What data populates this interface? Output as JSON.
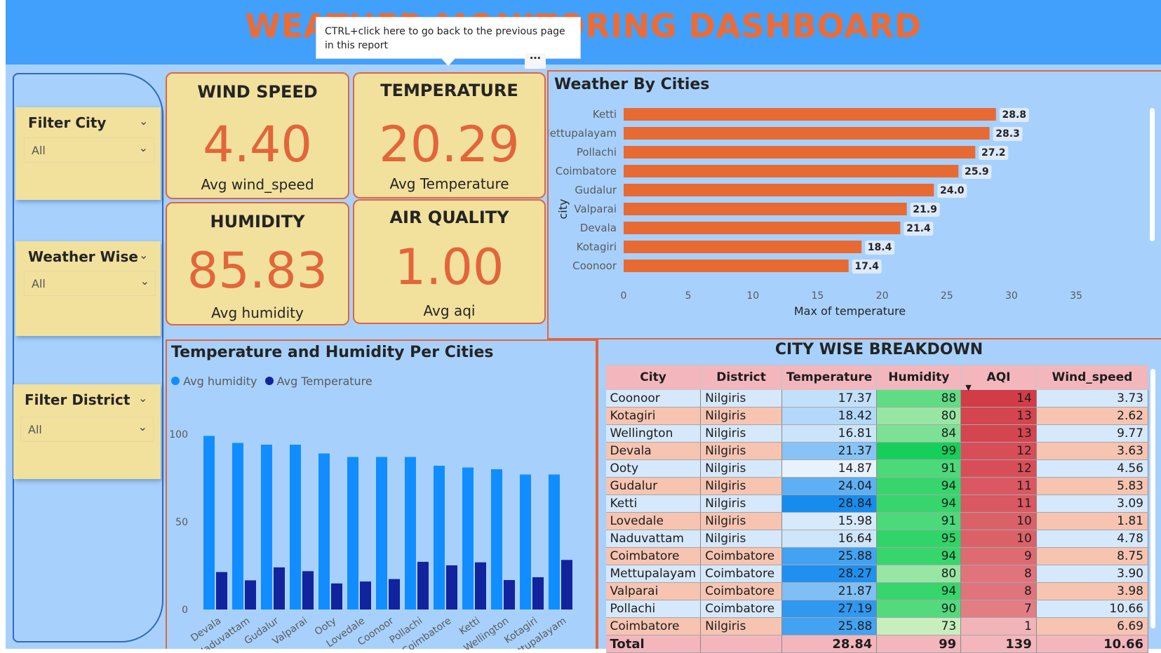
{
  "header": {
    "title": "WEATHER MONITORING DASHBOARD"
  },
  "tooltip": {
    "text": "CTRL+click here to go back to the previous page in this report",
    "more_icon": "⋯"
  },
  "filters": [
    {
      "title": "Filter City",
      "value": "All"
    },
    {
      "title": "Weather Wise",
      "value": "All"
    },
    {
      "title": "Filter District",
      "value": "All"
    }
  ],
  "kpis": {
    "wind": {
      "title": "WIND SPEED",
      "value": "4.40",
      "subtitle": "Avg wind_speed"
    },
    "temperature": {
      "title": "TEMPERATURE",
      "value": "20.29",
      "subtitle": "Avg Temperature"
    },
    "humidity": {
      "title": "HUMIDITY",
      "value": "85.83",
      "subtitle": "Avg humidity"
    },
    "aqi": {
      "title": "AIR QUALITY",
      "value": "1.00",
      "subtitle": "Avg aqi"
    }
  },
  "colors": {
    "bar": "#e86a33",
    "humidity": "#118dff",
    "temperature": "#12239e",
    "kpi_bg": "#f1e19d",
    "accent": "#e2653b",
    "canvas": "#a7d1fc"
  },
  "chart_data": [
    {
      "type": "bar",
      "orientation": "horizontal",
      "title": "Weather By Cities",
      "xlabel": "Max of temperature",
      "ylabel": "city",
      "categories": [
        "Ketti",
        "Mettupalayam",
        "Pollachi",
        "Coimbatore",
        "Gudalur",
        "Valparai",
        "Devala",
        "Kotagiri",
        "Coonoor"
      ],
      "values": [
        28.8,
        28.3,
        27.2,
        25.9,
        24.0,
        21.9,
        21.4,
        18.4,
        17.4
      ],
      "value_labels": [
        "28.8",
        "28.3",
        "27.2",
        "25.9",
        "24.0",
        "21.9",
        "21.4",
        "18.4",
        "17.4"
      ],
      "xlim": [
        0,
        35
      ],
      "xticks": [
        "0",
        "5",
        "10",
        "15",
        "20",
        "25",
        "30",
        "35"
      ]
    },
    {
      "type": "bar",
      "title": "Temperature and Humidity Per Cities",
      "categories": [
        "Devala",
        "Naduvattam",
        "Gudalur",
        "Valparai",
        "Ooty",
        "Lovedale",
        "Coonoor",
        "Pollachi",
        "Coimbatore",
        "Ketti",
        "Wellington",
        "Kotagiri",
        "Mettupalayam"
      ],
      "series": [
        {
          "name": "Avg humidity",
          "values": [
            99,
            95,
            94,
            94,
            89,
            87,
            87,
            87,
            82,
            81,
            80,
            77,
            77
          ]
        },
        {
          "name": "Avg Temperature",
          "values": [
            21.37,
            16.64,
            24.04,
            21.87,
            14.87,
            15.98,
            17.37,
            27.19,
            25.2,
            26.9,
            16.81,
            18.42,
            28.27
          ]
        }
      ],
      "ylim": [
        0,
        100
      ],
      "yticks": [
        "0",
        "50",
        "100"
      ]
    }
  ],
  "table": {
    "title": "CITY WISE BREAKDOWN",
    "columns": [
      "City",
      "District",
      "Temperature",
      "Humidity",
      "AQI",
      "Wind_speed"
    ],
    "sort_icon": "▼",
    "rows": [
      [
        "Coonoor",
        "Nilgiris",
        "17.37",
        "88",
        "14",
        "3.73"
      ],
      [
        "Kotagiri",
        "Nilgiris",
        "18.42",
        "80",
        "13",
        "2.62"
      ],
      [
        "Wellington",
        "Nilgiris",
        "16.81",
        "84",
        "13",
        "9.77"
      ],
      [
        "Devala",
        "Nilgiris",
        "21.37",
        "99",
        "12",
        "3.63"
      ],
      [
        "Ooty",
        "Nilgiris",
        "14.87",
        "91",
        "12",
        "4.56"
      ],
      [
        "Gudalur",
        "Nilgiris",
        "24.04",
        "94",
        "11",
        "5.83"
      ],
      [
        "Ketti",
        "Nilgiris",
        "28.84",
        "94",
        "11",
        "3.09"
      ],
      [
        "Lovedale",
        "Nilgiris",
        "15.98",
        "91",
        "10",
        "1.81"
      ],
      [
        "Naduvattam",
        "Nilgiris",
        "16.64",
        "95",
        "10",
        "4.78"
      ],
      [
        "Coimbatore",
        "Coimbatore",
        "25.88",
        "94",
        "9",
        "8.75"
      ],
      [
        "Mettupalayam",
        "Coimbatore",
        "28.27",
        "80",
        "8",
        "3.90"
      ],
      [
        "Valparai",
        "Coimbatore",
        "21.87",
        "94",
        "8",
        "3.98"
      ],
      [
        "Pollachi",
        "Coimbatore",
        "27.19",
        "90",
        "7",
        "10.66"
      ],
      [
        "Coimbatore",
        "Nilgiris",
        "25.88",
        "73",
        "1",
        "6.69"
      ]
    ],
    "total": [
      "Total",
      "",
      "28.84",
      "99",
      "139",
      "10.66"
    ]
  }
}
